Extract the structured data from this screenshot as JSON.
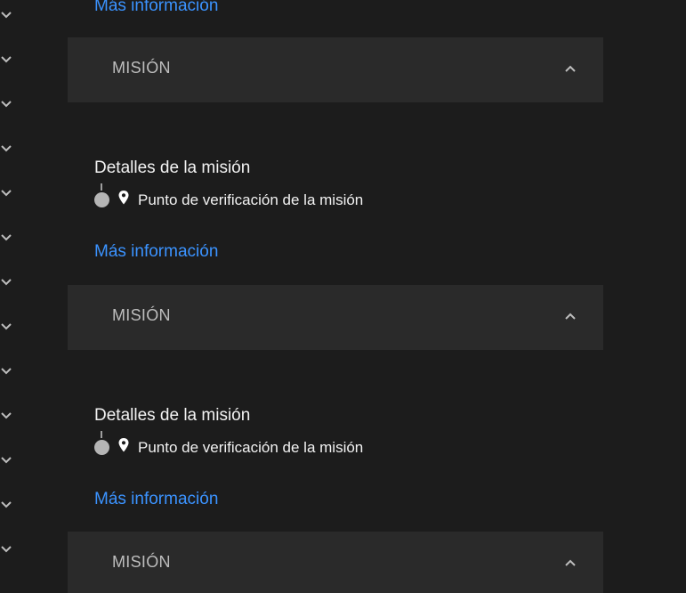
{
  "more_info_label": "Más información",
  "sections": [
    {
      "title": "MISIÓN"
    },
    {
      "title": "MISIÓN"
    },
    {
      "title": "MISIÓN"
    }
  ],
  "details": [
    {
      "title": "Detalles de la misión",
      "checkpoint": "Punto de verificación de la misión"
    },
    {
      "title": "Detalles de la misión",
      "checkpoint": "Punto de verificación de la misión"
    }
  ],
  "colors": {
    "background": "#1c1c1c",
    "header_background": "#2a2a2a",
    "link": "#3b93ff",
    "text": "#f2f2f2",
    "muted_text": "#bdbdbd"
  },
  "icons": {
    "rail": "chevron-down-icon",
    "header_toggle": "chevron-up-icon",
    "checkpoint": "map-pin-icon"
  }
}
